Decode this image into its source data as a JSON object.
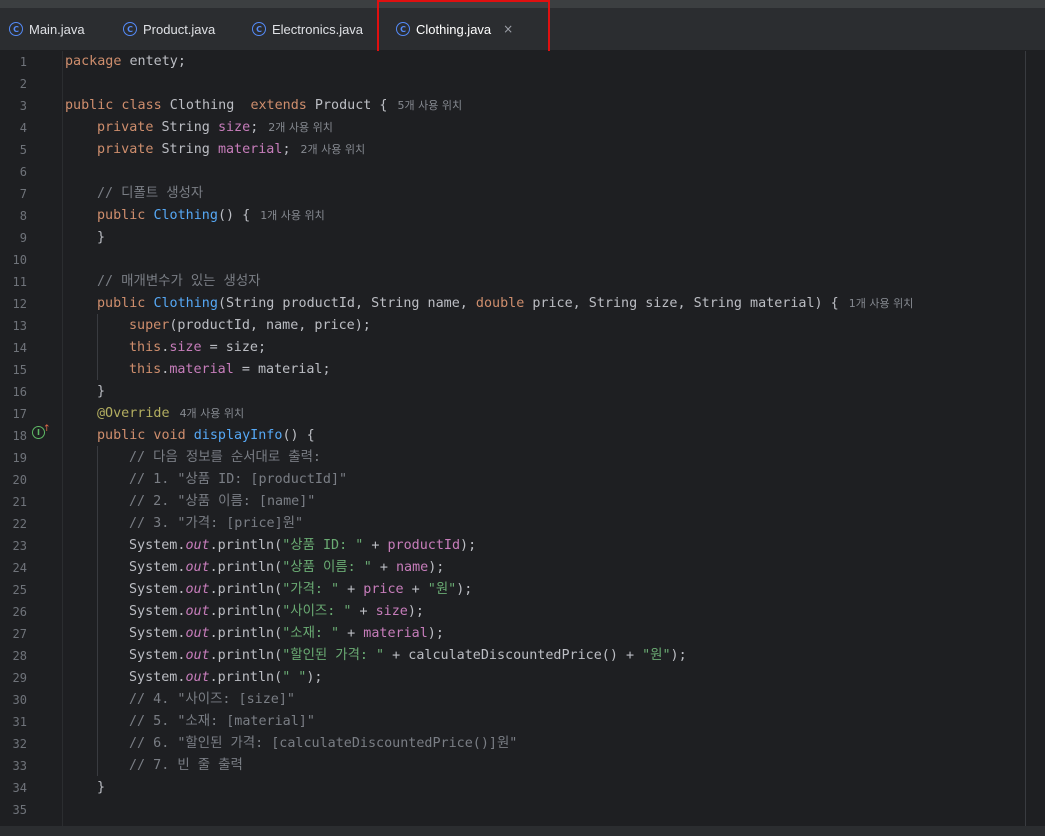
{
  "tabs": [
    {
      "label": "Main.java",
      "icon": "java-run-class-icon"
    },
    {
      "label": "Product.java",
      "icon": "java-class-icon"
    },
    {
      "label": "Electronics.java",
      "icon": "java-class-icon"
    },
    {
      "label": "Clothing.java",
      "icon": "java-class-icon",
      "active": true,
      "close": "×"
    }
  ],
  "hints": {
    "h3": "5개 사용 위치",
    "h4": "2개 사용 위치",
    "h5": "2개 사용 위치",
    "h8": "1개 사용 위치",
    "h12": "1개 사용 위치",
    "h17": "4개 사용 위치"
  },
  "code": {
    "l1_a": "package",
    "l1_b": " entety;",
    "l3_a": "public class",
    "l3_b": " Clothing  ",
    "l3_c": "extends",
    "l3_d": " Product {",
    "l4_a": "private",
    "l4_b": " String ",
    "l4_c": "size",
    "l4_d": ";",
    "l5_a": "private",
    "l5_b": " String ",
    "l5_c": "material",
    "l5_d": ";",
    "l7": "// 디폴트 생성자",
    "l8_a": "public",
    "l8_b": "Clothing",
    "l8_c": "() {",
    "l9": "}",
    "l11": "// 매개변수가 있는 생성자",
    "l12_a": "public",
    "l12_b": "Clothing",
    "l12_c": "(String productId, String name, ",
    "l12_d": "double",
    "l12_e": " price, String size, String material) {",
    "l13_a": "super",
    "l13_b": "(productId, name, price);",
    "l14_a": "this",
    "l14_b": ".",
    "l14_c": "size",
    "l14_d": " = size;",
    "l15_a": "this",
    "l15_b": ".",
    "l15_c": "material",
    "l15_d": " = material;",
    "l16": "}",
    "l17": "@Override",
    "l18_a": "public void",
    "l18_b": "displayInfo",
    "l18_c": "() {",
    "l19": "// 다음 정보를 순서대로 출력:",
    "l20": "// 1. \"상품 ID: [productId]\"",
    "l21": "// 2. \"상품 이름: [name]\"",
    "l22": "// 3. \"가격: [price]원\"",
    "sys": "System.",
    "out": "out",
    "println": ".println(",
    "l23_s": "\"상품 ID: \"",
    "l23_b": " + ",
    "l23_f": "productId",
    "l23_e": ");",
    "l24_s": "\"상품 이름: \"",
    "l24_b": " + ",
    "l24_f": "name",
    "l24_e": ");",
    "l25_s": "\"가격: \"",
    "l25_b": " + ",
    "l25_f": "price",
    "l25_c": " + ",
    "l25_s2": "\"원\"",
    "l25_e": ");",
    "l26_s": "\"사이즈: \"",
    "l26_b": " + ",
    "l26_f": "size",
    "l26_e": ");",
    "l27_s": "\"소재: \"",
    "l27_b": " + ",
    "l27_f": "material",
    "l27_e": ");",
    "l28_s": "\"할인된 가격: \"",
    "l28_b": " + calculateDiscountedPrice() + ",
    "l28_s2": "\"원\"",
    "l28_e": ");",
    "l29_s": "\" \"",
    "l29_e": ");",
    "l30": "// 4. \"사이즈: [size]\"",
    "l31": "// 5. \"소재: [material]\"",
    "l32": "// 6. \"할인된 가격: [calculateDiscountedPrice()]원\"",
    "l33": "// 7. 빈 줄 출력",
    "l34": "}"
  },
  "line_numbers": [
    "1",
    "2",
    "3",
    "4",
    "5",
    "6",
    "7",
    "8",
    "9",
    "10",
    "11",
    "12",
    "13",
    "14",
    "15",
    "16",
    "17",
    "18",
    "19",
    "20",
    "21",
    "22",
    "23",
    "24",
    "25",
    "26",
    "27",
    "28",
    "29",
    "30",
    "31",
    "32",
    "33",
    "34",
    "35"
  ],
  "colors": {
    "background": "#1e1f22",
    "keyword": "#cf8e6d",
    "field": "#c77dbb",
    "method": "#56a8f5",
    "string": "#6aab73",
    "comment": "#7a7e85",
    "annotation": "#b3ae60",
    "highlight_box": "#e01010"
  }
}
